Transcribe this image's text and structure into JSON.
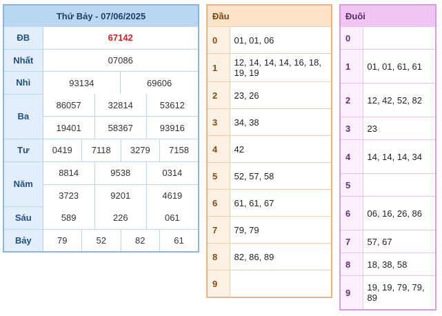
{
  "main": {
    "title": "Thứ Bảy - 07/06/2025",
    "rows": {
      "db": {
        "label": "ĐB",
        "values": [
          "67142"
        ]
      },
      "nhat": {
        "label": "Nhất",
        "values": [
          "07086"
        ]
      },
      "nhi": {
        "label": "Nhì",
        "values": [
          "93134",
          "69606"
        ]
      },
      "ba": {
        "label": "Ba",
        "values": [
          "86057",
          "32814",
          "53612",
          "19401",
          "58367",
          "93916"
        ]
      },
      "tu": {
        "label": "Tư",
        "values": [
          "0419",
          "7118",
          "3279",
          "7158"
        ]
      },
      "nam": {
        "label": "Năm",
        "values": [
          "8814",
          "9538",
          "0314",
          "3723",
          "9201",
          "4619"
        ]
      },
      "sau": {
        "label": "Sáu",
        "values": [
          "589",
          "226",
          "061"
        ]
      },
      "bay": {
        "label": "Bảy",
        "values": [
          "79",
          "52",
          "82",
          "61"
        ]
      }
    }
  },
  "dau": {
    "title": "Đầu",
    "rows": [
      {
        "idx": "0",
        "val": "01, 01, 06"
      },
      {
        "idx": "1",
        "val": "12, 14, 14, 14, 16, 18, 19, 19"
      },
      {
        "idx": "2",
        "val": "23, 26"
      },
      {
        "idx": "3",
        "val": "34, 38"
      },
      {
        "idx": "4",
        "val": "42"
      },
      {
        "idx": "5",
        "val": "52, 57, 58"
      },
      {
        "idx": "6",
        "val": "61, 61, 67"
      },
      {
        "idx": "7",
        "val": "79, 79"
      },
      {
        "idx": "8",
        "val": "82, 86, 89"
      },
      {
        "idx": "9",
        "val": ""
      }
    ]
  },
  "duoi": {
    "title": "Đuôi",
    "rows": [
      {
        "idx": "0",
        "val": ""
      },
      {
        "idx": "1",
        "val": "01, 01, 61, 61"
      },
      {
        "idx": "2",
        "val": "12, 42, 52, 82"
      },
      {
        "idx": "3",
        "val": "23"
      },
      {
        "idx": "4",
        "val": "14, 14, 14, 34"
      },
      {
        "idx": "5",
        "val": ""
      },
      {
        "idx": "6",
        "val": "06, 16, 26, 86"
      },
      {
        "idx": "7",
        "val": "57, 67"
      },
      {
        "idx": "8",
        "val": "18, 38, 58"
      },
      {
        "idx": "9",
        "val": "19, 19, 79, 79, 89"
      }
    ]
  },
  "colors": {
    "special_prize": "#d62020",
    "main_border": "#8ab4e6",
    "dau_border": "#f0b47a",
    "duoi_border": "#d79ce0"
  }
}
